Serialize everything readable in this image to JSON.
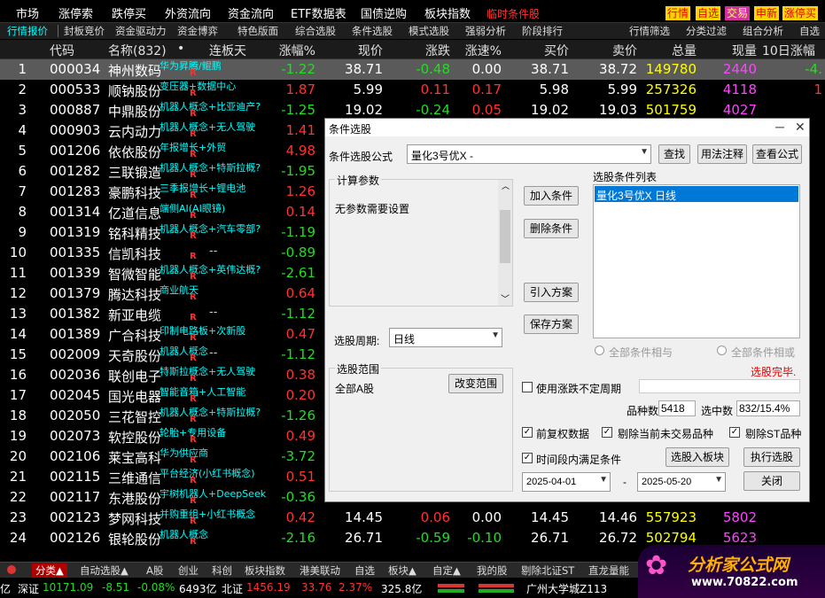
{
  "menu": {
    "items": [
      "市场",
      "涨停索",
      "跌停买",
      "外资流向",
      "资金流向",
      "ETF数据表",
      "国债逆购",
      "板块指数"
    ],
    "hot": "临时条件股",
    "right_buttons": [
      "行情",
      "自选",
      "交易",
      "申新",
      "涨停买"
    ]
  },
  "tabs": [
    "行情报价",
    "封板竞价",
    "资金驱动力",
    "资金博弈",
    "特色版面",
    "综合选股",
    "条件选股",
    "模式选股",
    "强弱分析",
    "阶段排行",
    "行情筛选",
    "分类过滤",
    "组合分析",
    "自选"
  ],
  "header": {
    "num": "",
    "code": "代码",
    "name": "名称(832)",
    "dot": "•",
    "board": "连板天",
    "pct": "涨幅%",
    "price": "现价",
    "chg": "涨跌",
    "speed": "涨速%",
    "bid": "买价",
    "ask": "卖价",
    "vol": "总量",
    "cur": "现量",
    "ten": "10日涨幅"
  },
  "rows": [
    {
      "n": "1",
      "code": "000034",
      "name": "神州数码",
      "concept": "华为昇腾/鲲鹏",
      "dash": "",
      "pct": "-1.22",
      "price": "38.71",
      "chg": "-0.48",
      "speed": "0.00",
      "bid": "38.71",
      "ask": "38.72",
      "vol": "149780",
      "cur": "2440",
      "ten": "-4."
    },
    {
      "n": "2",
      "code": "000533",
      "name": "顺钠股份",
      "concept": "变压器+数据中心",
      "dash": "",
      "pct": "1.87",
      "price": "5.99",
      "chg": "0.11",
      "speed": "0.17",
      "bid": "5.98",
      "ask": "5.99",
      "vol": "257326",
      "cur": "4118",
      "ten": "1"
    },
    {
      "n": "3",
      "code": "000887",
      "name": "中鼎股份",
      "concept": "机器人概念+比亚迪产?",
      "dash": "",
      "pct": "-1.25",
      "price": "19.02",
      "chg": "-0.24",
      "speed": "0.05",
      "bid": "19.02",
      "ask": "19.03",
      "vol": "501759",
      "cur": "4027",
      "ten": ""
    },
    {
      "n": "4",
      "code": "000903",
      "name": "云内动力",
      "concept": "机器人概念+无人驾驶",
      "dash": "",
      "pct": "1.41",
      "price": "",
      "chg": "",
      "speed": "",
      "bid": "",
      "ask": "",
      "vol": "",
      "cur": "",
      "ten": ""
    },
    {
      "n": "5",
      "code": "001206",
      "name": "依依股份",
      "concept": "年报增长+外贸",
      "dash": "",
      "pct": "4.98",
      "price": "",
      "chg": "",
      "speed": "",
      "bid": "",
      "ask": "",
      "vol": "",
      "cur": "",
      "ten": ""
    },
    {
      "n": "6",
      "code": "001282",
      "name": "三联锻造",
      "concept": "机器人概念+特斯拉概?",
      "dash": "",
      "pct": "-1.95",
      "price": "",
      "chg": "",
      "speed": "",
      "bid": "",
      "ask": "",
      "vol": "",
      "cur": "",
      "ten": ""
    },
    {
      "n": "7",
      "code": "001283",
      "name": "豪鹏科技",
      "concept": "三季报增长+锂电池",
      "dash": "",
      "pct": "1.26",
      "price": "",
      "chg": "",
      "speed": "",
      "bid": "",
      "ask": "",
      "vol": "",
      "cur": "",
      "ten": ""
    },
    {
      "n": "8",
      "code": "001314",
      "name": "亿道信息",
      "concept": "端侧AI(AI眼镜)",
      "dash": "",
      "pct": "0.14",
      "price": "",
      "chg": "",
      "speed": "",
      "bid": "",
      "ask": "",
      "vol": "",
      "cur": "",
      "ten": ""
    },
    {
      "n": "9",
      "code": "001319",
      "name": "铭科精技",
      "concept": "机器人概念+汽车零部?",
      "dash": "",
      "pct": "-1.19",
      "price": "",
      "chg": "",
      "speed": "",
      "bid": "",
      "ask": "",
      "vol": "",
      "cur": "",
      "ten": ""
    },
    {
      "n": "10",
      "code": "001335",
      "name": "信凯科技",
      "concept": "",
      "dash": "--",
      "pct": "-0.89",
      "price": "",
      "chg": "",
      "speed": "",
      "bid": "",
      "ask": "",
      "vol": "",
      "cur": "",
      "ten": ""
    },
    {
      "n": "11",
      "code": "001339",
      "name": "智微智能",
      "concept": "机器人概念+英伟达概?",
      "dash": "",
      "pct": "-2.61",
      "price": "",
      "chg": "",
      "speed": "",
      "bid": "",
      "ask": "",
      "vol": "",
      "cur": "",
      "ten": ""
    },
    {
      "n": "12",
      "code": "001379",
      "name": "腾达科技",
      "concept": "商业航天",
      "dash": "",
      "pct": "0.64",
      "price": "",
      "chg": "",
      "speed": "",
      "bid": "",
      "ask": "",
      "vol": "",
      "cur": "",
      "ten": ""
    },
    {
      "n": "13",
      "code": "001382",
      "name": "新亚电缆",
      "concept": "",
      "dash": "--",
      "pct": "-1.12",
      "price": "",
      "chg": "",
      "speed": "",
      "bid": "",
      "ask": "",
      "vol": "",
      "cur": "",
      "ten": ""
    },
    {
      "n": "14",
      "code": "001389",
      "name": "广合科技",
      "concept": "印制电路板+次新股",
      "dash": "",
      "pct": "0.47",
      "price": "",
      "chg": "",
      "speed": "",
      "bid": "",
      "ask": "",
      "vol": "",
      "cur": "",
      "ten": ""
    },
    {
      "n": "15",
      "code": "002009",
      "name": "天奇股份",
      "concept": "机器人概念",
      "dash": "--",
      "pct": "-1.12",
      "price": "",
      "chg": "",
      "speed": "",
      "bid": "",
      "ask": "",
      "vol": "",
      "cur": "",
      "ten": ""
    },
    {
      "n": "16",
      "code": "002036",
      "name": "联创电子",
      "concept": "特斯拉概念+无人驾驶",
      "dash": "",
      "pct": "0.38",
      "price": "",
      "chg": "",
      "speed": "",
      "bid": "",
      "ask": "",
      "vol": "",
      "cur": "",
      "ten": ""
    },
    {
      "n": "17",
      "code": "002045",
      "name": "国光电器",
      "concept": "智能音箱+人工智能",
      "dash": "",
      "pct": "0.20",
      "price": "",
      "chg": "",
      "speed": "",
      "bid": "",
      "ask": "",
      "vol": "",
      "cur": "",
      "ten": ""
    },
    {
      "n": "18",
      "code": "002050",
      "name": "三花智控",
      "concept": "机器人概念+特斯拉概?",
      "dash": "",
      "pct": "-1.26",
      "price": "",
      "chg": "",
      "speed": "",
      "bid": "",
      "ask": "",
      "vol": "",
      "cur": "",
      "ten": ""
    },
    {
      "n": "19",
      "code": "002073",
      "name": "软控股份",
      "concept": "轮胎+专用设备",
      "dash": "",
      "pct": "0.49",
      "price": "",
      "chg": "",
      "speed": "",
      "bid": "",
      "ask": "",
      "vol": "",
      "cur": "",
      "ten": ""
    },
    {
      "n": "20",
      "code": "002106",
      "name": "莱宝高科",
      "concept": "华为供应商",
      "dash": "",
      "pct": "-3.72",
      "price": "",
      "chg": "",
      "speed": "",
      "bid": "",
      "ask": "",
      "vol": "",
      "cur": "",
      "ten": ""
    },
    {
      "n": "21",
      "code": "002115",
      "name": "三维通信",
      "concept": "平台经济(小红书概念)",
      "dash": "",
      "pct": "0.51",
      "price": "",
      "chg": "",
      "speed": "",
      "bid": "",
      "ask": "",
      "vol": "",
      "cur": "",
      "ten": ""
    },
    {
      "n": "22",
      "code": "002117",
      "name": "东港股份",
      "concept": "宇树机器人+DeepSeek",
      "dash": "",
      "pct": "-0.36",
      "price": "",
      "chg": "",
      "speed": "",
      "bid": "",
      "ask": "",
      "vol": "",
      "cur": "",
      "ten": ""
    },
    {
      "n": "23",
      "code": "002123",
      "name": "梦网科技",
      "concept": "并购重组+小红书概念",
      "dash": "",
      "pct": "0.42",
      "price": "14.45",
      "chg": "0.06",
      "speed": "0.00",
      "bid": "14.45",
      "ask": "14.46",
      "vol": "557923",
      "cur": "5802",
      "ten": ""
    },
    {
      "n": "24",
      "code": "002126",
      "name": "银轮股份",
      "concept": "机器人概念",
      "dash": "",
      "pct": "-2.16",
      "price": "26.71",
      "chg": "-0.59",
      "speed": "-0.10",
      "bid": "26.71",
      "ask": "26.72",
      "vol": "502794",
      "cur": "5623",
      "ten": ""
    }
  ],
  "bottom_tabs": [
    "分类▲",
    "自动选股▲",
    "A股",
    "创业",
    "科创",
    "板块指数",
    "港美联动",
    "自选",
    "板块▲",
    "自定▲",
    "我的股",
    "剔除北证ST",
    "直龙量能"
  ],
  "status": {
    "sz_label": "深证",
    "sz_val": "10171.09",
    "sz_chg": "-8.51",
    "sz_pct": "-0.08%",
    "sz_amt": "6493亿",
    "bz_label": "北证",
    "bz_val": "1456.19",
    "bz_chg": "33.76",
    "bz_pct": "2.37%",
    "bz_amt": "325.8亿",
    "loc": "广州大学城Z113",
    "left": "亿"
  },
  "logo": {
    "text": "分析家公式网",
    "url": "www.70822.com"
  },
  "dialog": {
    "title": "条件选股",
    "formula_label": "条件选股公式",
    "formula_value": "量化3号优X  -",
    "btn_find": "查找",
    "btn_usage": "用法注释",
    "btn_view": "查看公式",
    "params_title": "计算参数",
    "params_text": "无参数需要设置",
    "btn_add": "加入条件",
    "btn_del": "删除条件",
    "btn_import": "引入方案",
    "btn_save": "保存方案",
    "list_title": "选股条件列表",
    "list_item": "量化3号优X  日线",
    "period_label": "选股周期:",
    "period_value": "日线",
    "radio_and": "全部条件相与",
    "radio_or": "全部条件相或",
    "done": "选股完毕.",
    "range_title": "选股范围",
    "range_value": "全部A股",
    "btn_range": "改变范围",
    "use_period": "使用涨跌不定周期",
    "count_label": "品种数",
    "count_value": "5418",
    "selected_label": "选中数",
    "selected_value": "832/15.4%",
    "cb_fq": "前复权数据",
    "cb_notrade": "剔除当前未交易品种",
    "cb_st": "剔除ST品种",
    "cb_range": "时间段内满足条件",
    "btn_toboard": "选股入板块",
    "btn_exec": "执行选股",
    "date_from": "2025-04-01",
    "date_to": "2025-05-20",
    "dash": "-",
    "btn_close": "关闭"
  }
}
